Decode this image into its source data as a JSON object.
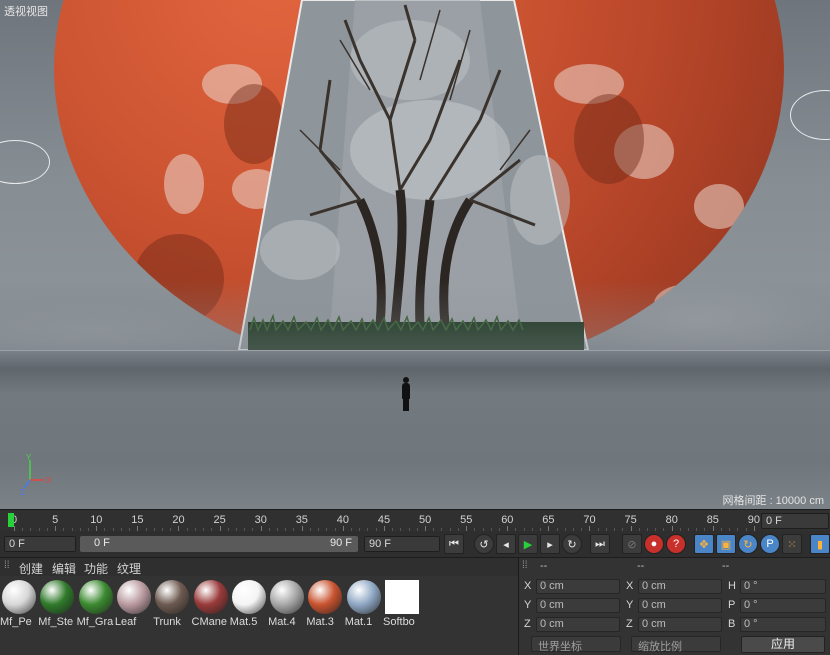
{
  "viewport": {
    "title": "透视视图",
    "grid_spacing": "网格间距 : 10000 cm",
    "axis_labels": {
      "y": "Y",
      "x": "X",
      "z": "Z"
    }
  },
  "timeline": {
    "ticks": [
      "0",
      "5",
      "10",
      "15",
      "20",
      "25",
      "30",
      "35",
      "40",
      "45",
      "50",
      "55",
      "60",
      "65",
      "70",
      "75",
      "80",
      "85",
      "90"
    ],
    "current_frame": "0 F",
    "start_frame": "0 F",
    "range_start": "0 F",
    "range_end": "90 F",
    "end_frame": "90 F",
    "current_frame_value": 0
  },
  "material_manager": {
    "menu": [
      "创建",
      "编辑",
      "功能",
      "纹理"
    ],
    "materials": [
      {
        "name": "Mf_Pe",
        "color": "#d8d8d8"
      },
      {
        "name": "Mf_Ste",
        "color": "#2f7a2a"
      },
      {
        "name": "Mf_Gra",
        "color": "#3b8a30"
      },
      {
        "name": "Leaf",
        "color": "#b99aa0"
      },
      {
        "name": "Trunk",
        "color": "#6d5a50"
      },
      {
        "name": "CMane",
        "color": "#9a3a3a"
      },
      {
        "name": "Mat.5",
        "color": "#f4f4f4"
      },
      {
        "name": "Mat.4",
        "color": "#a8a8a8"
      },
      {
        "name": "Mat.3",
        "color": "#c9532f"
      },
      {
        "name": "Mat.1",
        "color": "#8fa8c4"
      },
      {
        "name": "Softbo",
        "color": "#ffffff"
      }
    ]
  },
  "coordinates": {
    "headers": [
      "--",
      "--",
      "--"
    ],
    "rows": [
      {
        "a": "X",
        "av": "0 cm",
        "b": "X",
        "bv": "0 cm",
        "c": "H",
        "cv": "0 °"
      },
      {
        "a": "Y",
        "av": "0 cm",
        "b": "Y",
        "bv": "0 cm",
        "c": "P",
        "cv": "0 °"
      },
      {
        "a": "Z",
        "av": "0 cm",
        "b": "Z",
        "bv": "0 cm",
        "c": "B",
        "cv": "0 °"
      }
    ],
    "world_select": "世界坐标",
    "scale_select": "缩放比例",
    "apply_label": "应用"
  }
}
